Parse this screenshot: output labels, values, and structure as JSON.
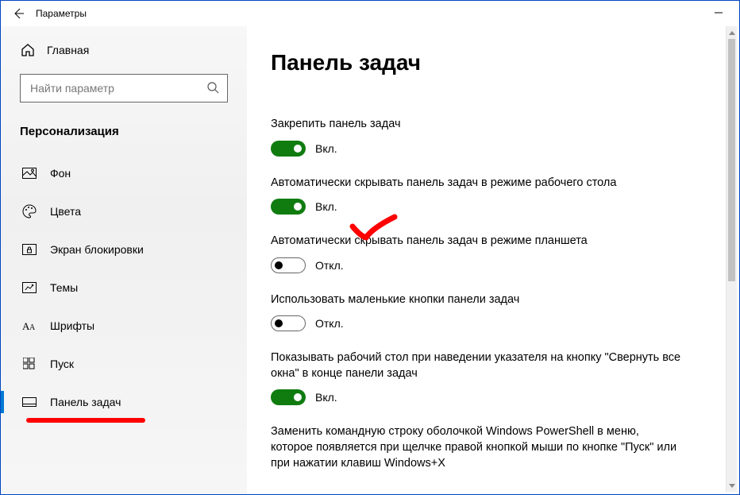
{
  "window": {
    "title": "Параметры"
  },
  "sidebar": {
    "home_label": "Главная",
    "search_placeholder": "Найти параметр",
    "category": "Персонализация",
    "items": [
      {
        "label": "Фон"
      },
      {
        "label": "Цвета"
      },
      {
        "label": "Экран блокировки"
      },
      {
        "label": "Темы"
      },
      {
        "label": "Шрифты"
      },
      {
        "label": "Пуск"
      },
      {
        "label": "Панель задач",
        "active": true
      }
    ]
  },
  "main": {
    "title": "Панель задач",
    "toggle_on": "Вкл.",
    "toggle_off": "Откл.",
    "settings": [
      {
        "label": "Закрепить панель задач",
        "on": true
      },
      {
        "label": "Автоматически скрывать панель задач в режиме рабочего стола",
        "on": true
      },
      {
        "label": "Автоматически скрывать панель задач в режиме планшета",
        "on": false
      },
      {
        "label": "Использовать маленькие кнопки панели задач",
        "on": false
      },
      {
        "label": "Показывать рабочий стол при наведении указателя на кнопку \"Свернуть все окна\" в конце панели задач",
        "on": true
      },
      {
        "label": "Заменить командную строку оболочкой Windows PowerShell в меню, которое появляется при щелчке правой кнопкой мыши по кнопке \"Пуск\" или при нажатии клавиш Windows+X"
      }
    ]
  }
}
